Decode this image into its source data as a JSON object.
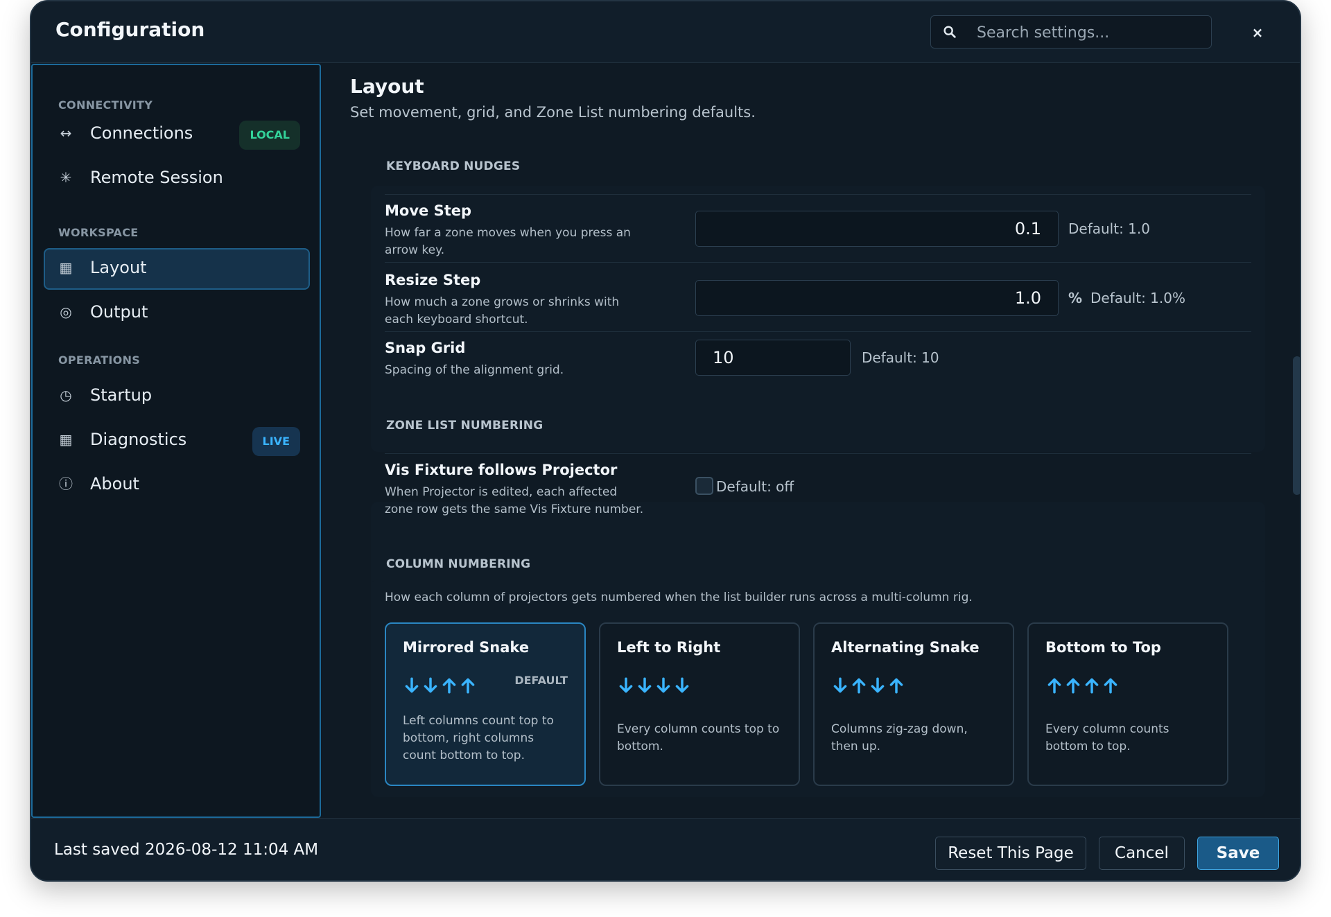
{
  "window": {
    "title": "Configuration",
    "close_glyph": "×"
  },
  "search": {
    "placeholder": "Search settings...",
    "icon": "search-icon"
  },
  "sidebar": {
    "sections": [
      {
        "label": "CONNECTIVITY"
      },
      {
        "label": "WORKSPACE"
      },
      {
        "label": "OPERATIONS"
      }
    ],
    "items": [
      {
        "label": "Connections",
        "icon": "arrows-horizontal-icon",
        "glyph": "↔",
        "badge": "LOCAL"
      },
      {
        "label": "Remote Session",
        "icon": "asterisk-icon",
        "glyph": "✳"
      },
      {
        "label": "Layout",
        "icon": "grid-icon",
        "glyph": "▦",
        "active": true
      },
      {
        "label": "Output",
        "icon": "target-icon",
        "glyph": "◎"
      },
      {
        "label": "Startup",
        "icon": "clock-icon",
        "glyph": "◷"
      },
      {
        "label": "Diagnostics",
        "icon": "chart-icon",
        "glyph": "▦",
        "badge": "LIVE"
      },
      {
        "label": "About",
        "icon": "info-icon",
        "glyph": "ⓘ"
      }
    ]
  },
  "page": {
    "title": "Layout",
    "subtitle": "Set movement, grid, and Zone List numbering defaults."
  },
  "keyboard_nudges": {
    "heading": "KEYBOARD NUDGES",
    "move_step": {
      "label": "Move Step",
      "help": "How far a zone moves when you press an arrow key.",
      "value": "0.1",
      "default": "Default: 1.0"
    },
    "resize_step": {
      "label": "Resize Step",
      "help": "How much a zone grows or shrinks with each keyboard shortcut.",
      "value": "1.0",
      "unit": "%",
      "default": "Default: 1.0%"
    },
    "snap_grid": {
      "label": "Snap Grid",
      "help": "Spacing of the alignment grid.",
      "value": "10",
      "default": "Default: 10"
    }
  },
  "zone_list": {
    "heading": "ZONE LIST NUMBERING",
    "vis_fixture": {
      "label": "Vis Fixture follows Projector",
      "help": "When Projector is edited, each affected zone row gets the same Vis Fixture number.",
      "checked": false,
      "default": "Default: off"
    }
  },
  "column_numbering": {
    "heading": "COLUMN NUMBERING",
    "description": "How each column of projectors gets numbered when the list builder runs across a multi-column rig.",
    "options": [
      {
        "title": "Mirrored Snake",
        "arrows": [
          "down",
          "down",
          "up",
          "up"
        ],
        "badge": "DEFAULT",
        "desc": "Left columns count top to bottom, right columns count bottom to top.",
        "selected": true
      },
      {
        "title": "Left to Right",
        "arrows": [
          "down",
          "down",
          "down",
          "down"
        ],
        "desc": "Every column counts top to bottom."
      },
      {
        "title": "Alternating Snake",
        "arrows": [
          "down",
          "up",
          "down",
          "up"
        ],
        "desc": "Columns zig-zag down, then up."
      },
      {
        "title": "Bottom to Top",
        "arrows": [
          "up",
          "up",
          "up",
          "up"
        ],
        "desc": "Every column counts bottom to top."
      }
    ],
    "arrow_color": "#3ab4ff"
  },
  "footer": {
    "last_saved": "Last saved 2026-08-12 11:04 AM",
    "reset_label": "Reset This Page",
    "cancel_label": "Cancel",
    "save_label": "Save"
  },
  "colors": {
    "accent": "#3ab4ff",
    "local_badge": "#33d39a",
    "background": "#0f1a24"
  }
}
